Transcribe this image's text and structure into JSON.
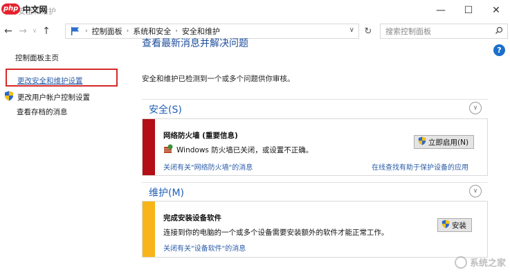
{
  "watermark": {
    "badge": "php",
    "text": "中文网"
  },
  "window": {
    "title": "安全和维护",
    "minimize": "—",
    "maximize": "☐",
    "close": "✕"
  },
  "nav": {
    "back": "←",
    "forward": "→",
    "up": "↑",
    "breadcrumbs": [
      "控制面板",
      "系统和安全",
      "安全和维护"
    ],
    "dropdown": "∨",
    "refresh": "↻",
    "search_placeholder": "搜索控制面板"
  },
  "sidebar": {
    "home": "控制面板主页",
    "security_settings": "更改安全和维护设置",
    "uac_settings": "更改用户帐户控制设置",
    "archived_messages": "查看存档的消息"
  },
  "help": "?",
  "main": {
    "title": "查看最新消息并解决问题",
    "subtitle": "安全和维护已检测到一个或多个问题供你审核。",
    "security": {
      "header": "安全(S)",
      "chevron": "∨",
      "card_title": "网络防火墙 (重要信息)",
      "card_text": "Windows 防火墙已关闭，或设置不正确。",
      "button": "立即启用(N)",
      "link_off": "关闭有关\"网络防火墙\"的消息",
      "link_online": "在线查找有助于保护设备的应用"
    },
    "maintenance": {
      "header": "维护(M)",
      "chevron": "∨",
      "card_title": "完成安装设备软件",
      "card_text": "连接到你的电脑的一个或多个设备需要安装额外的软件才能正常工作。",
      "button": "安装",
      "link_off": "关闭有关\"设备软件\"的消息"
    }
  },
  "site_watermark": "系统之家",
  "colors": {
    "accent_blue": "#1f5fb5",
    "danger_red": "#b30f16",
    "warning_yellow": "#f7b519",
    "highlight_red": "#d62828"
  }
}
